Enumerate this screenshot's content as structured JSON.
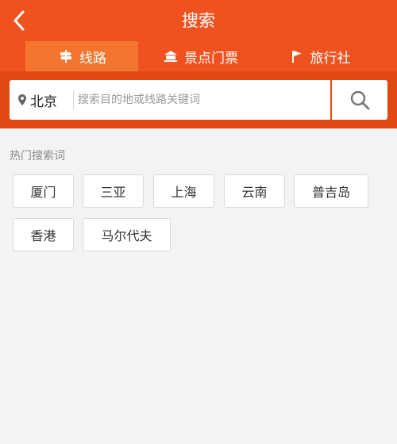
{
  "header": {
    "title": "搜索"
  },
  "tabs": [
    {
      "label": "线路",
      "icon": "signpost-icon",
      "active": true
    },
    {
      "label": "景点门票",
      "icon": "temple-icon",
      "active": false
    },
    {
      "label": "旅行社",
      "icon": "flag-icon",
      "active": false
    }
  ],
  "search": {
    "city": "北京",
    "placeholder": "搜索目的地或线路关键词",
    "value": ""
  },
  "hot": {
    "title": "热门搜索词",
    "keywords": [
      "厦门",
      "三亚",
      "上海",
      "云南",
      "普吉岛",
      "香港",
      "马尔代夫"
    ]
  },
  "colors": {
    "header": "#f0521f",
    "active_tab": "#f4752e",
    "search_strip": "#e24814",
    "background": "#f3f3f3"
  }
}
